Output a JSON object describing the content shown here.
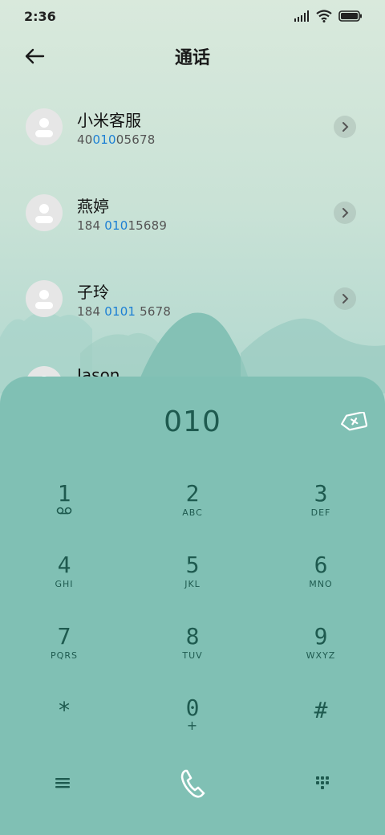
{
  "status": {
    "time": "2:36"
  },
  "header": {
    "title": "通话"
  },
  "contacts": [
    {
      "name": "小米客服",
      "number_pre": "40",
      "number_match": "010",
      "number_post": "05678"
    },
    {
      "name": "燕婷",
      "number_pre": "184 ",
      "number_match": "010",
      "number_post": "15689"
    },
    {
      "name": "子玲",
      "number_pre": "184 ",
      "number_match": "0101",
      "number_post": " 5678"
    },
    {
      "name": "Jason",
      "number_pre": "",
      "number_match": "",
      "number_post": ""
    }
  ],
  "dialpad": {
    "input": "010",
    "keys": [
      {
        "digit": "1",
        "letters": ""
      },
      {
        "digit": "2",
        "letters": "ABC"
      },
      {
        "digit": "3",
        "letters": "DEF"
      },
      {
        "digit": "4",
        "letters": "GHI"
      },
      {
        "digit": "5",
        "letters": "JKL"
      },
      {
        "digit": "6",
        "letters": "MNO"
      },
      {
        "digit": "7",
        "letters": "PQRS"
      },
      {
        "digit": "8",
        "letters": "TUV"
      },
      {
        "digit": "9",
        "letters": "WXYZ"
      },
      {
        "digit": "*",
        "letters": ""
      },
      {
        "digit": "0",
        "letters": "+"
      },
      {
        "digit": "#",
        "letters": ""
      }
    ]
  },
  "colors": {
    "accent": "#1c7fd4",
    "dialpad_bg": "#80c0b4",
    "dial_text": "#1e5a4f"
  },
  "icons": {
    "back": "arrow-left-icon",
    "backspace": "backspace-icon",
    "menu": "menu-icon",
    "call": "phone-icon",
    "keypad": "keypad-icon",
    "voicemail": "voicemail-icon"
  }
}
